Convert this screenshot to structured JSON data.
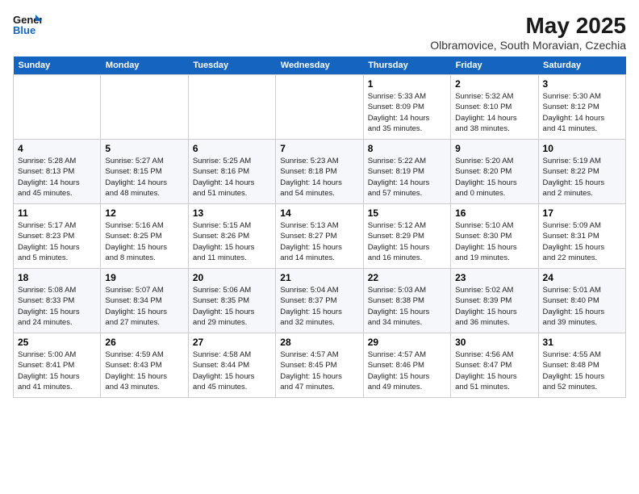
{
  "logo": {
    "line1": "General",
    "line2": "Blue"
  },
  "title": "May 2025",
  "location": "Olbramovice, South Moravian, Czechia",
  "days_of_week": [
    "Sunday",
    "Monday",
    "Tuesday",
    "Wednesday",
    "Thursday",
    "Friday",
    "Saturday"
  ],
  "weeks": [
    [
      {
        "day": "",
        "content": ""
      },
      {
        "day": "",
        "content": ""
      },
      {
        "day": "",
        "content": ""
      },
      {
        "day": "",
        "content": ""
      },
      {
        "day": "1",
        "content": "Sunrise: 5:33 AM\nSunset: 8:09 PM\nDaylight: 14 hours\nand 35 minutes."
      },
      {
        "day": "2",
        "content": "Sunrise: 5:32 AM\nSunset: 8:10 PM\nDaylight: 14 hours\nand 38 minutes."
      },
      {
        "day": "3",
        "content": "Sunrise: 5:30 AM\nSunset: 8:12 PM\nDaylight: 14 hours\nand 41 minutes."
      }
    ],
    [
      {
        "day": "4",
        "content": "Sunrise: 5:28 AM\nSunset: 8:13 PM\nDaylight: 14 hours\nand 45 minutes."
      },
      {
        "day": "5",
        "content": "Sunrise: 5:27 AM\nSunset: 8:15 PM\nDaylight: 14 hours\nand 48 minutes."
      },
      {
        "day": "6",
        "content": "Sunrise: 5:25 AM\nSunset: 8:16 PM\nDaylight: 14 hours\nand 51 minutes."
      },
      {
        "day": "7",
        "content": "Sunrise: 5:23 AM\nSunset: 8:18 PM\nDaylight: 14 hours\nand 54 minutes."
      },
      {
        "day": "8",
        "content": "Sunrise: 5:22 AM\nSunset: 8:19 PM\nDaylight: 14 hours\nand 57 minutes."
      },
      {
        "day": "9",
        "content": "Sunrise: 5:20 AM\nSunset: 8:20 PM\nDaylight: 15 hours\nand 0 minutes."
      },
      {
        "day": "10",
        "content": "Sunrise: 5:19 AM\nSunset: 8:22 PM\nDaylight: 15 hours\nand 2 minutes."
      }
    ],
    [
      {
        "day": "11",
        "content": "Sunrise: 5:17 AM\nSunset: 8:23 PM\nDaylight: 15 hours\nand 5 minutes."
      },
      {
        "day": "12",
        "content": "Sunrise: 5:16 AM\nSunset: 8:25 PM\nDaylight: 15 hours\nand 8 minutes."
      },
      {
        "day": "13",
        "content": "Sunrise: 5:15 AM\nSunset: 8:26 PM\nDaylight: 15 hours\nand 11 minutes."
      },
      {
        "day": "14",
        "content": "Sunrise: 5:13 AM\nSunset: 8:27 PM\nDaylight: 15 hours\nand 14 minutes."
      },
      {
        "day": "15",
        "content": "Sunrise: 5:12 AM\nSunset: 8:29 PM\nDaylight: 15 hours\nand 16 minutes."
      },
      {
        "day": "16",
        "content": "Sunrise: 5:10 AM\nSunset: 8:30 PM\nDaylight: 15 hours\nand 19 minutes."
      },
      {
        "day": "17",
        "content": "Sunrise: 5:09 AM\nSunset: 8:31 PM\nDaylight: 15 hours\nand 22 minutes."
      }
    ],
    [
      {
        "day": "18",
        "content": "Sunrise: 5:08 AM\nSunset: 8:33 PM\nDaylight: 15 hours\nand 24 minutes."
      },
      {
        "day": "19",
        "content": "Sunrise: 5:07 AM\nSunset: 8:34 PM\nDaylight: 15 hours\nand 27 minutes."
      },
      {
        "day": "20",
        "content": "Sunrise: 5:06 AM\nSunset: 8:35 PM\nDaylight: 15 hours\nand 29 minutes."
      },
      {
        "day": "21",
        "content": "Sunrise: 5:04 AM\nSunset: 8:37 PM\nDaylight: 15 hours\nand 32 minutes."
      },
      {
        "day": "22",
        "content": "Sunrise: 5:03 AM\nSunset: 8:38 PM\nDaylight: 15 hours\nand 34 minutes."
      },
      {
        "day": "23",
        "content": "Sunrise: 5:02 AM\nSunset: 8:39 PM\nDaylight: 15 hours\nand 36 minutes."
      },
      {
        "day": "24",
        "content": "Sunrise: 5:01 AM\nSunset: 8:40 PM\nDaylight: 15 hours\nand 39 minutes."
      }
    ],
    [
      {
        "day": "25",
        "content": "Sunrise: 5:00 AM\nSunset: 8:41 PM\nDaylight: 15 hours\nand 41 minutes."
      },
      {
        "day": "26",
        "content": "Sunrise: 4:59 AM\nSunset: 8:43 PM\nDaylight: 15 hours\nand 43 minutes."
      },
      {
        "day": "27",
        "content": "Sunrise: 4:58 AM\nSunset: 8:44 PM\nDaylight: 15 hours\nand 45 minutes."
      },
      {
        "day": "28",
        "content": "Sunrise: 4:57 AM\nSunset: 8:45 PM\nDaylight: 15 hours\nand 47 minutes."
      },
      {
        "day": "29",
        "content": "Sunrise: 4:57 AM\nSunset: 8:46 PM\nDaylight: 15 hours\nand 49 minutes."
      },
      {
        "day": "30",
        "content": "Sunrise: 4:56 AM\nSunset: 8:47 PM\nDaylight: 15 hours\nand 51 minutes."
      },
      {
        "day": "31",
        "content": "Sunrise: 4:55 AM\nSunset: 8:48 PM\nDaylight: 15 hours\nand 52 minutes."
      }
    ]
  ]
}
